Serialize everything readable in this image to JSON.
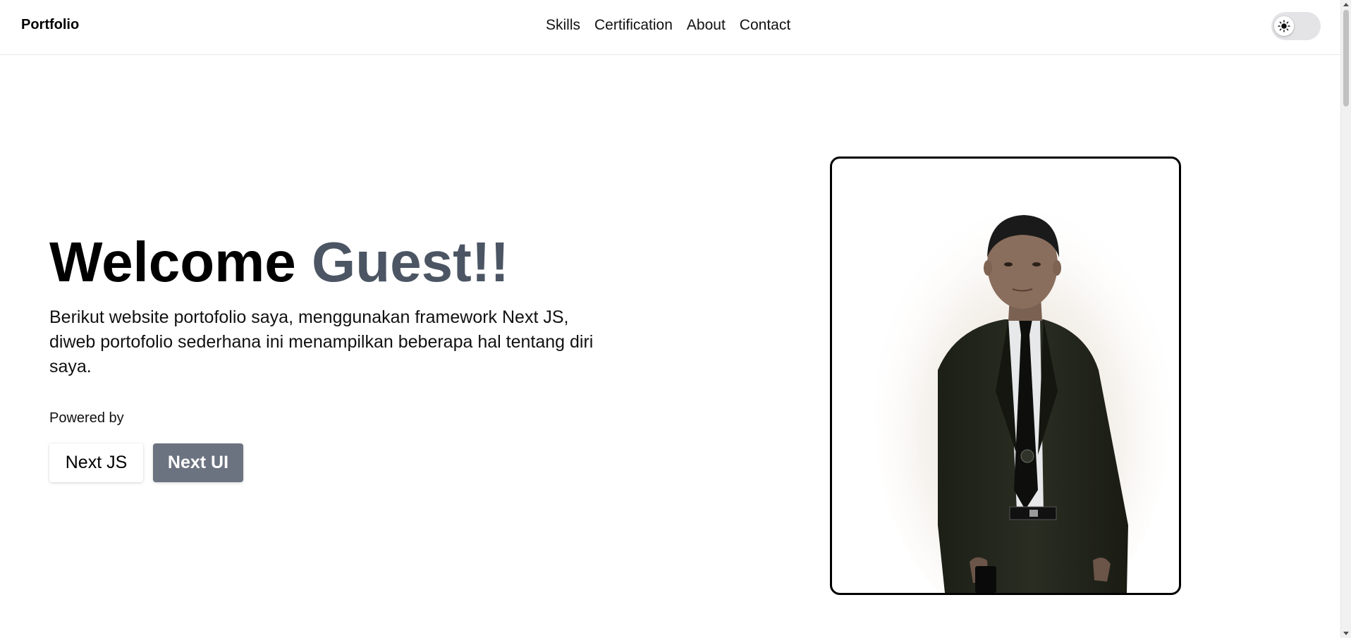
{
  "header": {
    "brand": "Portfolio",
    "nav": [
      {
        "label": "Skills"
      },
      {
        "label": "Certification"
      },
      {
        "label": "About"
      },
      {
        "label": "Contact"
      }
    ],
    "theme_toggle_icon": "sun-icon"
  },
  "hero": {
    "title_main": "Welcome",
    "title_accent": "Guest!!",
    "description": "Berikut website portofolio saya, menggunakan framework Next JS, diweb portofolio sederhana ini menampilkan beberapa hal tentang diri saya.",
    "powered_by_label": "Powered by",
    "badges": [
      {
        "label": "Next JS"
      },
      {
        "label": "Next UI"
      }
    ]
  },
  "colors": {
    "accent_text": "#4b5563",
    "badge_dark": "#6b7280"
  }
}
